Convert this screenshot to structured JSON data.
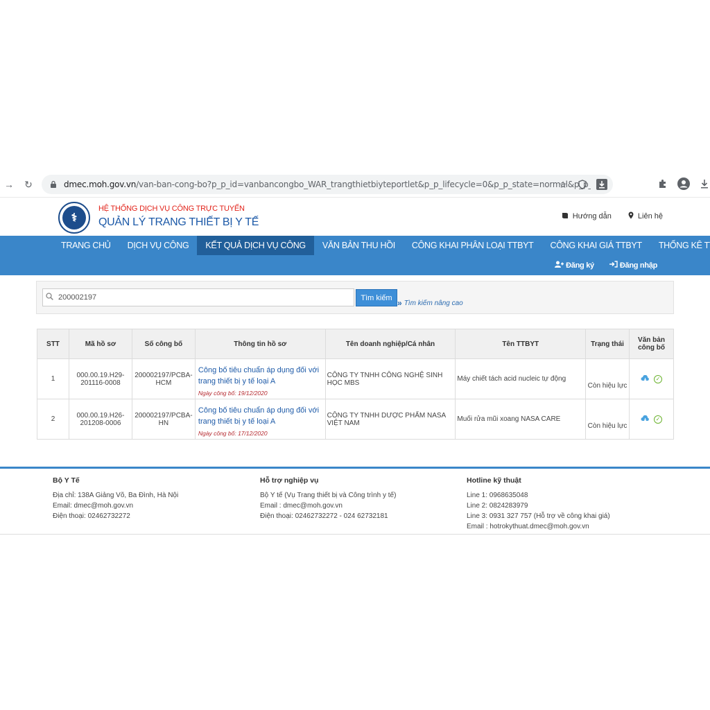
{
  "browser": {
    "url_domain": "dmec.moh.gov.vn",
    "url_path": "/van-ban-cong-bo?p_p_id=vanbancongbo_WAR_trangthietbiyteportlet&p_p_lifecycle=0&p_p_state=normal&p_p_mode=view&p_p_col_i..."
  },
  "header": {
    "logo_text": "BỘ Y TẾ",
    "subtitle": "HỆ THỐNG DỊCH VỤ CÔNG TRỰC TUYẾN",
    "title": "QUẢN LÝ TRANG THIẾT BỊ Y TẾ",
    "links": [
      {
        "label": "Hướng dẫn",
        "icon": "book-icon"
      },
      {
        "label": "Liên hệ",
        "icon": "map-pin-icon"
      }
    ]
  },
  "nav": {
    "items": [
      "TRANG CHỦ",
      "DỊCH VỤ CÔNG",
      "KẾT QUẢ DỊCH VỤ CÔNG",
      "VĂN BẢN THU HỒI",
      "CÔNG KHAI PHÂN LOẠI TTBYT",
      "CÔNG KHAI GIÁ TTBYT",
      "THỐNG KÊ TTBYT"
    ],
    "active_index": 2,
    "register": "Đăng ký",
    "login": "Đăng nhập"
  },
  "search": {
    "value": "200002197",
    "button": "Tìm kiếm",
    "advanced": "Tìm kiếm nâng cao"
  },
  "table": {
    "headers": [
      "STT",
      "Mã hồ sơ",
      "Số công bố",
      "Thông tin hồ sơ",
      "Tên doanh nghiệp/Cá nhân",
      "Tên TTBYT",
      "Trạng thái",
      "Văn bản công bố"
    ],
    "rows": [
      {
        "stt": "1",
        "ma_ho_so": "000.00.19.H29-201116-0008",
        "so_cong_bo": "200002197/PCBA-HCM",
        "info_title": "Công bố tiêu chuẩn áp dụng đối với trang thiết bị y tế loại A",
        "info_date": "Ngày công bố: 19/12/2020",
        "doanh_nghiep": "CÔNG TY TNHH CÔNG NGHỆ SINH HỌC MBS",
        "ten_ttbyt": "Máy chiết tách acid nucleic tự động",
        "trang_thai": "Còn hiệu lực"
      },
      {
        "stt": "2",
        "ma_ho_so": "000.00.19.H26-201208-0006",
        "so_cong_bo": "200002197/PCBA-HN",
        "info_title": "Công bố tiêu chuẩn áp dụng đối với trang thiết bị y tế loại A",
        "info_date": "Ngày công bố: 17/12/2020",
        "doanh_nghiep": "CÔNG TY TNHH DƯỢC PHẨM NASA VIỆT NAM",
        "ten_ttbyt": "Muối rửa mũi xoang NASA CARE",
        "trang_thai": "Còn hiệu lực"
      }
    ]
  },
  "footer": {
    "col1": {
      "title": "Bộ Y Tế",
      "lines": [
        "Địa chỉ: 138A Giảng Võ, Ba Đình, Hà Nội",
        "Email: dmec@moh.gov.vn",
        "Điện thoại: 02462732272"
      ]
    },
    "col2": {
      "title": "Hỗ trợ nghiệp vụ",
      "lines": [
        "Bộ Y tế (Vụ Trang thiết bị và Công trình y tế)",
        "Email : dmec@moh.gov.vn",
        "Điện thoại: 02462732272 - 024 62732181"
      ]
    },
    "col3": {
      "title": "Hotline kỹ thuật",
      "lines": [
        "Line 1: 0968635048",
        "Line 2: 0824283979",
        "Line 3: 0931 327 757 (Hỗ trợ về công khai giá)",
        "Email : hotrokythuat.dmec@moh.gov.vn"
      ]
    }
  }
}
